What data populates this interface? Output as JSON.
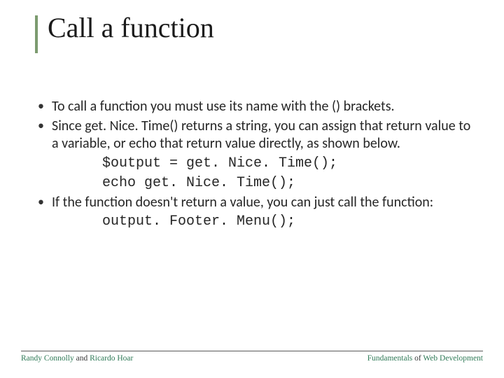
{
  "title": "Call a function",
  "bullets": {
    "b1": "To call a function you must use its name with the () brackets.",
    "b2_part1": "Since ",
    "b2_code": "get. Nice. Time()",
    "b2_part2": "  returns a string, you can assign that return value to a variable, or echo that return value directly, as shown below.",
    "code1_line1": "$output = get. Nice. Time();",
    "code1_line2": "echo get. Nice. Time();",
    "b3": "If the function doesn't return a value, you can just call the function:",
    "code2_line1": "output. Footer. Menu();"
  },
  "footer": {
    "left_a": "Randy Connolly",
    "left_mid": " and ",
    "left_b": "Ricardo Hoar",
    "right_a": "Fundamentals",
    "right_mid": " of ",
    "right_b": "Web Development"
  }
}
